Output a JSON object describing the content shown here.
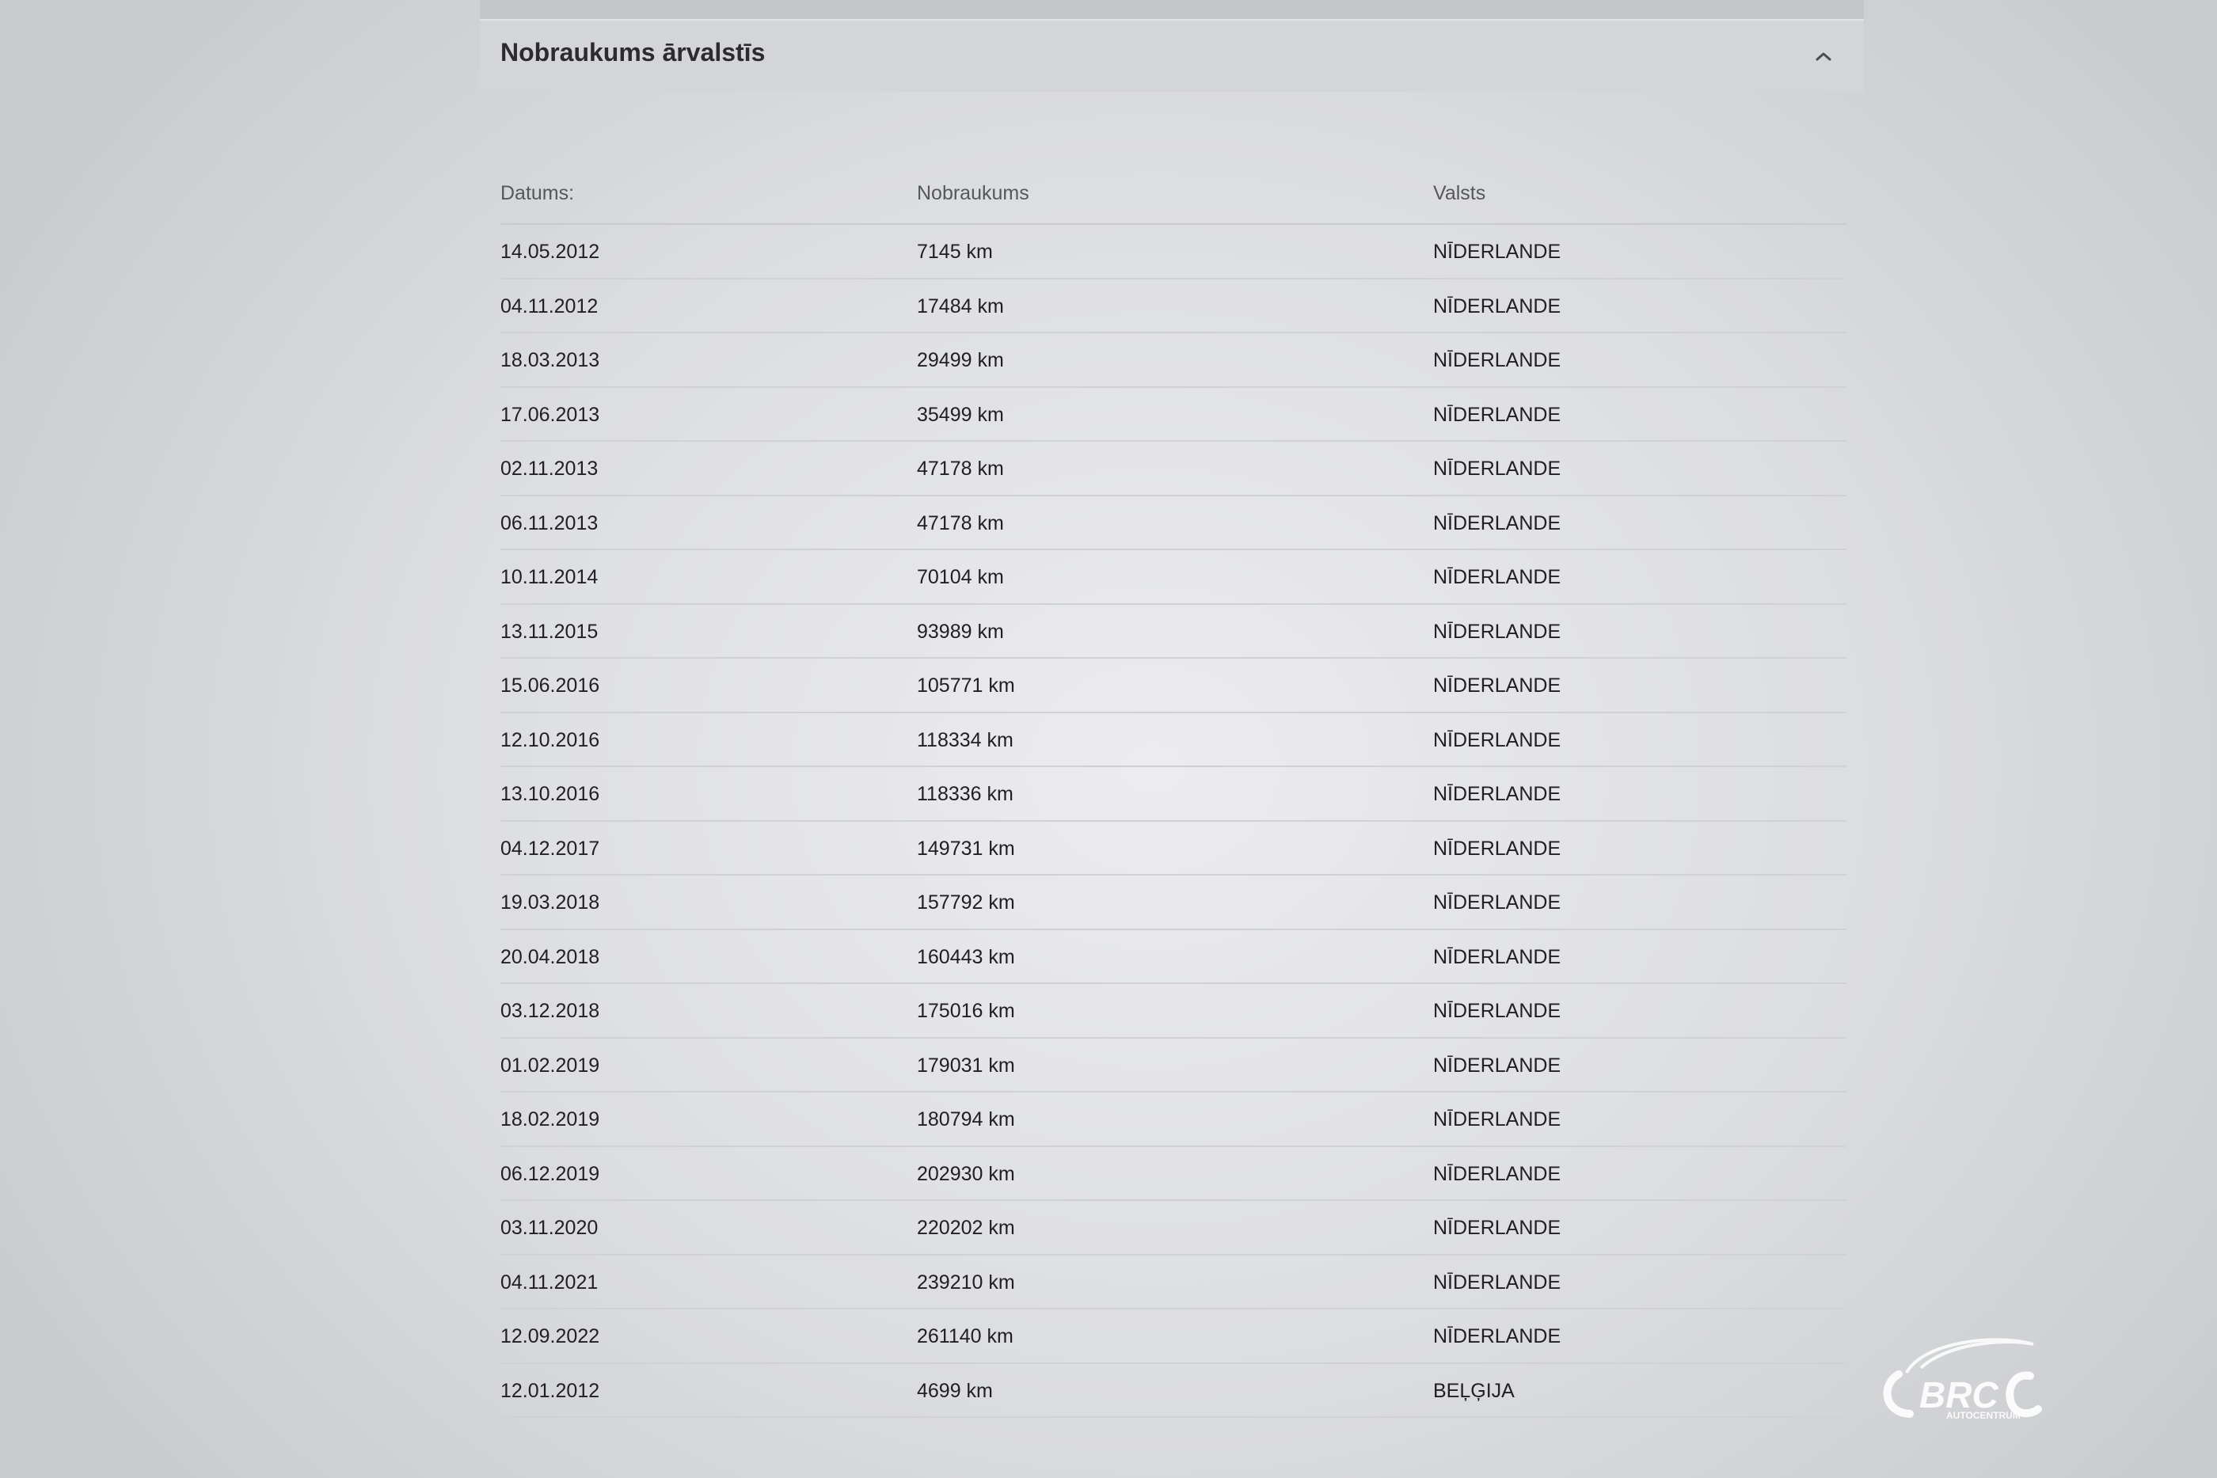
{
  "section": {
    "title": "Nobraukums ārvalstīs"
  },
  "table": {
    "headers": {
      "date": "Datums:",
      "mileage": "Nobraukums",
      "country": "Valsts"
    },
    "rows": [
      {
        "date": "14.05.2012",
        "mileage": "7145 km",
        "country": "NĪDERLANDE"
      },
      {
        "date": "04.11.2012",
        "mileage": "17484 km",
        "country": "NĪDERLANDE"
      },
      {
        "date": "18.03.2013",
        "mileage": "29499 km",
        "country": "NĪDERLANDE"
      },
      {
        "date": "17.06.2013",
        "mileage": "35499 km",
        "country": "NĪDERLANDE"
      },
      {
        "date": "02.11.2013",
        "mileage": "47178 km",
        "country": "NĪDERLANDE"
      },
      {
        "date": "06.11.2013",
        "mileage": "47178 km",
        "country": "NĪDERLANDE"
      },
      {
        "date": "10.11.2014",
        "mileage": "70104 km",
        "country": "NĪDERLANDE"
      },
      {
        "date": "13.11.2015",
        "mileage": "93989 km",
        "country": "NĪDERLANDE"
      },
      {
        "date": "15.06.2016",
        "mileage": "105771 km",
        "country": "NĪDERLANDE"
      },
      {
        "date": "12.10.2016",
        "mileage": "118334 km",
        "country": "NĪDERLANDE"
      },
      {
        "date": "13.10.2016",
        "mileage": "118336 km",
        "country": "NĪDERLANDE"
      },
      {
        "date": "04.12.2017",
        "mileage": "149731 km",
        "country": "NĪDERLANDE"
      },
      {
        "date": "19.03.2018",
        "mileage": "157792 km",
        "country": "NĪDERLANDE"
      },
      {
        "date": "20.04.2018",
        "mileage": "160443 km",
        "country": "NĪDERLANDE"
      },
      {
        "date": "03.12.2018",
        "mileage": "175016 km",
        "country": "NĪDERLANDE"
      },
      {
        "date": "01.02.2019",
        "mileage": "179031 km",
        "country": "NĪDERLANDE"
      },
      {
        "date": "18.02.2019",
        "mileage": "180794 km",
        "country": "NĪDERLANDE"
      },
      {
        "date": "06.12.2019",
        "mileage": "202930 km",
        "country": "NĪDERLANDE"
      },
      {
        "date": "03.11.2020",
        "mileage": "220202 km",
        "country": "NĪDERLANDE"
      },
      {
        "date": "04.11.2021",
        "mileage": "239210 km",
        "country": "NĪDERLANDE"
      },
      {
        "date": "12.09.2022",
        "mileage": "261140 km",
        "country": "NĪDERLANDE"
      },
      {
        "date": "12.01.2012",
        "mileage": "4699 km",
        "country": "BEĻĢIJA"
      }
    ]
  },
  "icons": {
    "collapse": "chevron-up-icon",
    "logo": "brc-autocentrum-logo"
  },
  "watermark": {
    "brand": "BRC",
    "subtitle": "AUTOCENTRUM"
  }
}
